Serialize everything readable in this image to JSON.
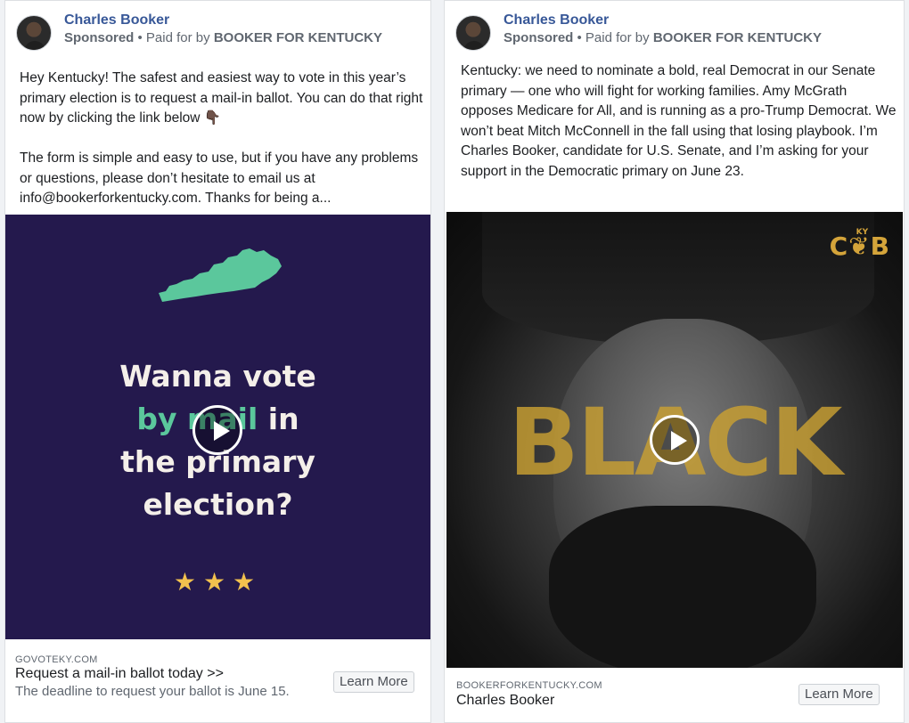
{
  "posts": [
    {
      "author": "Charles Booker",
      "sponsored_label": "Sponsored",
      "paid_for_prefix": " • Paid for by ",
      "payer": "BOOKER FOR KENTUCKY",
      "body": "Hey Kentucky! The safest and easiest way to vote in this year’s primary election is to request a mail-in ballot. You can do that right now by clicking the link below 👇🏿\n\nThe form is simple and easy to use, but if you have any problems or questions, please don’t hesitate to email us at info@bookerforkentucky.com. Thanks for being a...",
      "creative": {
        "headline_line1": "Wanna vote",
        "headline_green": "by mail",
        "headline_after_green": " in",
        "headline_line3": "the primary",
        "headline_line4": "election?",
        "stars": "★★★",
        "background_color": "#24194d",
        "accent_color": "#5bc79c",
        "play_icon": "play-icon",
        "map_icon": "kentucky-map-shape"
      },
      "link": {
        "domain": "GOVOTEKY.COM",
        "title": "Request a mail-in ballot today >>",
        "description": "The deadline to request your ballot is June 15.",
        "cta": "Learn More"
      }
    },
    {
      "author": "Charles Booker",
      "sponsored_label": "Sponsored",
      "paid_for_prefix": " • Paid for by ",
      "payer": "BOOKER FOR KENTUCKY",
      "body": "Kentucky: we need to nominate a bold, real Democrat in our Senate primary — one who will fight for working families. Amy McGrath opposes Medicare for All, and is running as a pro-Trump Democrat. We won’t beat Mitch McConnell in the fall using that losing playbook. I’m Charles Booker, candidate for U.S. Senate, and I’m asking for your support in the Democratic primary on June 23.",
      "creative": {
        "overlay_word": "BLACK",
        "logo_text": "C❦B",
        "logo_small": "KY",
        "accent_color": "#c9a032",
        "play_icon": "play-icon"
      },
      "link": {
        "domain": "BOOKERFORKENTUCKY.COM",
        "title": "Charles Booker",
        "cta": "Learn More"
      }
    }
  ]
}
